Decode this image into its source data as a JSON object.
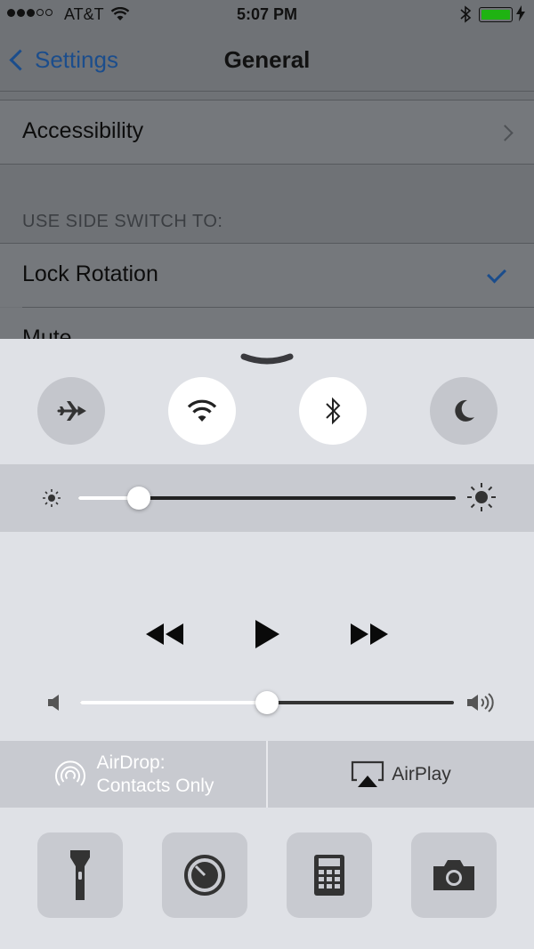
{
  "status_bar": {
    "carrier": "AT&T",
    "time": "5:07 PM",
    "signal_bars_filled": 3,
    "signal_bars_total": 5,
    "battery_level": 1.0,
    "battery_color": "#1fb312"
  },
  "nav": {
    "back_label": "Settings",
    "title": "General"
  },
  "settings": {
    "accessibility_label": "Accessibility",
    "section_header": "USE SIDE SWITCH TO:",
    "lock_rotation_label": "Lock Rotation",
    "mute_label": "Mute",
    "selected": "Lock Rotation"
  },
  "control_center": {
    "toggles": [
      {
        "name": "airplane-mode",
        "icon": "airplane-icon",
        "active": false
      },
      {
        "name": "wifi",
        "icon": "wifi-icon",
        "active": true
      },
      {
        "name": "bluetooth",
        "icon": "bluetooth-icon",
        "active": true
      },
      {
        "name": "do-not-disturb",
        "icon": "moon-icon",
        "active": false
      }
    ],
    "brightness_level": 0.16,
    "volume_level": 0.5,
    "media_controls": [
      "rewind-icon",
      "play-icon",
      "fast-forward-icon"
    ],
    "airdrop_line1": "AirDrop:",
    "airdrop_line2": "Contacts Only",
    "airplay_label": "AirPlay",
    "tools": [
      "flashlight-icon",
      "timer-icon",
      "calculator-icon",
      "camera-icon"
    ]
  }
}
